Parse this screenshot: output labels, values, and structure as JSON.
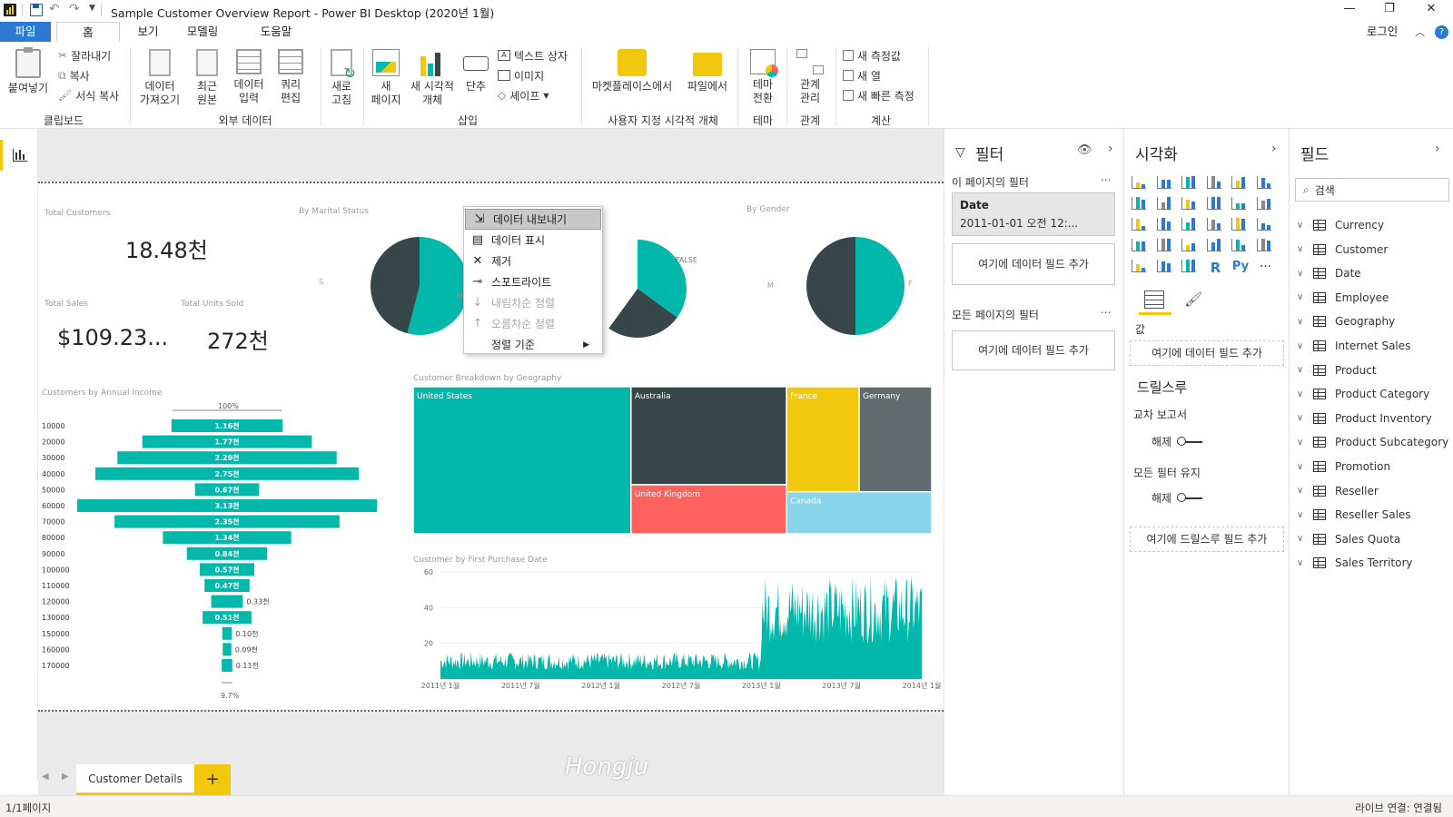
{
  "window": {
    "title": "Sample Customer Overview Report - Power BI Desktop (2020년 1월)",
    "minimize": "—",
    "maximize": "❐",
    "close": "✕"
  },
  "ribbon": {
    "tabs": [
      "파일",
      "홈",
      "보기",
      "모델링",
      "도움말"
    ],
    "login": "로그인",
    "clipboard": {
      "paste": "붙여넣기",
      "cut": "잘라내기",
      "copy": "복사",
      "format_copy": "서식 복사",
      "label": "클립보드"
    },
    "external": {
      "get_data_1": "데이터",
      "get_data_2": "가져오기",
      "recent_1": "최근",
      "recent_2": "원본",
      "enter_1": "데이터",
      "enter_2": "입력",
      "edit_1": "쿼리",
      "edit_2": "편집",
      "label": "외부 데이터"
    },
    "refresh_1": "새로",
    "refresh_2": "고침",
    "insert": {
      "new_page_1": "새",
      "new_page_2": "페이지",
      "new_visual_1": "새 시각적",
      "new_visual_2": "개체",
      "button": "단추",
      "textbox": "텍스트 상자",
      "image": "이미지",
      "shapes": "셰이프",
      "label": "삽입"
    },
    "custom": {
      "marketplace": "마켓플레이스에서",
      "from_file": "파일에서",
      "label": "사용자 지정 시각적 개체"
    },
    "theme": {
      "switch_1": "테마",
      "switch_2": "전환",
      "label": "테마"
    },
    "relations": {
      "manage_1": "관계",
      "manage_2": "관리",
      "label": "관계"
    },
    "calc": {
      "new_measure": "새 측정값",
      "new_column": "새 열",
      "new_quick": "새 빠른 측정",
      "label": "계산"
    }
  },
  "report": {
    "total_customers": {
      "title": "Total Customers",
      "value": "18.48천"
    },
    "total_sales": {
      "title": "Total Sales",
      "value": "$109.23..."
    },
    "total_units": {
      "title": "Total Units Sold",
      "value": "272천"
    },
    "marital": {
      "title": "By Marital Status",
      "label_s": "S",
      "label_m": "M"
    },
    "gender": {
      "title": "By Gender",
      "label_m": "M",
      "label_f": "F"
    },
    "third_pie": {
      "label_false": "FALSE"
    },
    "funnel": {
      "title": "Customers by Annual Income",
      "top_pct": "100%",
      "bottom_pct": "9.7%"
    },
    "treemap": {
      "title": "Customer Breakdown by Geography"
    },
    "area": {
      "title": "Customer by First Purchase Date"
    }
  },
  "context_menu": {
    "items": [
      "데이터 내보내기",
      "데이터 표시",
      "제거",
      "스포트라이트",
      "내림차순 정렬",
      "오름차순 정렬",
      "정렬 기준"
    ]
  },
  "page_tabs": {
    "active": "Customer Details",
    "add": "+",
    "watermark": "Hongju"
  },
  "filters": {
    "header": "필터",
    "this_page": "이 페이지의 필터",
    "date_field": "Date",
    "date_value": "2011-01-01 오전 12:...",
    "add_field": "여기에 데이터 필드 추가",
    "all_pages": "모든 페이지의 필터",
    "ellipsis": "..."
  },
  "visualizations": {
    "header": "시각화",
    "values_label": "값",
    "add_field": "여기에 데이터 필드 추가",
    "drillthrough": "드릴스루",
    "cross_report": "교차 보고서",
    "off_1": "해제",
    "keep_filters": "모든 필터 유지",
    "off_2": "해제",
    "add_drill": "여기에 드릴스루 필드 추가",
    "more": "···"
  },
  "fields": {
    "header": "필드",
    "search_placeholder": "검색",
    "tables": [
      "Currency",
      "Customer",
      "Date",
      "Employee",
      "Geography",
      "Internet Sales",
      "Product",
      "Product Category",
      "Product Inventory",
      "Product Subcategory",
      "Promotion",
      "Reseller",
      "Reseller Sales",
      "Sales Quota",
      "Sales Territory"
    ]
  },
  "status": {
    "page": "1/1페이지",
    "connection": "라이브 연결: 연결됨"
  },
  "colors": {
    "teal": "#01B8AA",
    "dark": "#374649",
    "red": "#FD625E",
    "yellow": "#F2C80F",
    "grey": "#5F6B6D",
    "lightblue": "#8AD4EB",
    "accent": "#F2C80F",
    "ribbon_blue": "#2B79D1"
  },
  "chart_data": [
    {
      "type": "pie",
      "title": "By Marital Status",
      "categories": [
        "M",
        "S"
      ],
      "values": [
        54,
        46
      ]
    },
    {
      "type": "pie",
      "title": "By Gender",
      "categories": [
        "F",
        "M"
      ],
      "values": [
        50,
        50
      ]
    },
    {
      "type": "funnel",
      "title": "Customers by Annual Income",
      "categories": [
        "10000",
        "20000",
        "30000",
        "40000",
        "50000",
        "60000",
        "70000",
        "80000",
        "90000",
        "100000",
        "110000",
        "120000",
        "130000",
        "150000",
        "160000",
        "170000"
      ],
      "values": [
        1.16,
        1.77,
        2.29,
        2.75,
        0.67,
        3.13,
        2.35,
        1.34,
        0.84,
        0.57,
        0.47,
        0.33,
        0.51,
        0.1,
        0.09,
        0.11
      ],
      "value_labels": [
        "1.16천",
        "1.77천",
        "2.29천",
        "2.75천",
        "0.67천",
        "3.13천",
        "2.35천",
        "1.34천",
        "0.84천",
        "0.57천",
        "0.47천",
        "0.33천",
        "0.51천",
        "0.10천",
        "0.09천",
        "0.11천"
      ]
    },
    {
      "type": "treemap",
      "title": "Customer Breakdown by Geography",
      "categories": [
        "United States",
        "Australia",
        "United Kingdom",
        "France",
        "Germany",
        "Canada"
      ],
      "values": [
        42,
        20,
        10,
        10,
        10,
        8
      ]
    },
    {
      "type": "area",
      "title": "Customer by First Purchase Date",
      "x_ticks": [
        "2011년 1월",
        "2011년 7월",
        "2012년 1월",
        "2012년 7월",
        "2013년 1월",
        "2013년 7월",
        "2014년 1월"
      ],
      "y_ticks": [
        0,
        20,
        40,
        60
      ],
      "ylim": [
        0,
        60
      ],
      "series": [
        {
          "period": "2011-01 to 2013-01",
          "typical_min": 5,
          "typical_max": 15
        },
        {
          "period": "2013-01 to 2014-01",
          "typical_min": 20,
          "typical_max": 58
        }
      ]
    }
  ]
}
